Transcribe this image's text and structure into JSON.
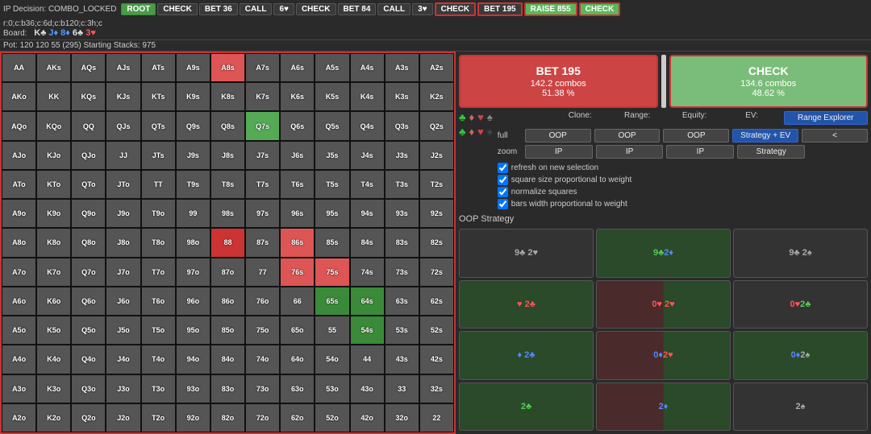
{
  "nav": {
    "ip_decision": "IP Decision: COMBO_LOCKED",
    "buttons": [
      {
        "label": "ROOT",
        "style": "green"
      },
      {
        "label": "CHECK",
        "style": "dark"
      },
      {
        "label": "BET 36",
        "style": "dark"
      },
      {
        "label": "CALL",
        "style": "dark"
      },
      {
        "label": "6♥",
        "style": "dark"
      },
      {
        "label": "CHECK",
        "style": "dark"
      },
      {
        "label": "BET 84",
        "style": "dark"
      },
      {
        "label": "CALL",
        "style": "dark"
      },
      {
        "label": "3♥",
        "style": "dark"
      },
      {
        "label": "CHECK",
        "style": "red-outline"
      },
      {
        "label": "BET 195",
        "style": "red-outline"
      },
      {
        "label": "RAISE 855",
        "style": "active-green"
      },
      {
        "label": "CHECK",
        "style": "active-green"
      }
    ]
  },
  "board": {
    "label": "Board:",
    "cards": [
      {
        "text": "K♣",
        "color": "black"
      },
      {
        "text": "J♦",
        "color": "blue"
      },
      {
        "text": "8♦",
        "color": "blue"
      },
      {
        "text": "6♣",
        "color": "black"
      },
      {
        "text": "3♥",
        "color": "red"
      }
    ]
  },
  "path": "r:0;c:b36;c:6d;c:b120;c:3h;c",
  "pot_info": "Pot: 120 120 55 (295) Starting Stacks: 975",
  "actions": {
    "bet": {
      "title": "BET 195",
      "combos": "142.2 combos",
      "pct": "51.38 %"
    },
    "check": {
      "title": "CHECK",
      "combos": "134.6 combos",
      "pct": "48.62 %"
    }
  },
  "controls": {
    "clone_label": "Clone:",
    "range_label": "Range:",
    "equity_label": "Equity:",
    "ev_label": "EV:",
    "range_explorer_label": "Range Explorer",
    "full_label": "full",
    "zoom_label": "zoom",
    "oop_labels": [
      "OOP",
      "OOP",
      "OOP"
    ],
    "ip_labels": [
      "IP",
      "IP",
      "IP"
    ],
    "strategy_ev": "Strategy + EV",
    "strategy": "Strategy",
    "checkboxes": [
      "refresh on new selection",
      "square size proportional to weight",
      "normalize squares",
      "bars width proportional to weight"
    ]
  },
  "oop_strategy_label": "OOP Strategy",
  "card_cells": [
    {
      "label": "9♣",
      "suit_color": "black",
      "rank": "2♥",
      "suit2_color": "red",
      "bg": "gray"
    },
    {
      "label": "9♣",
      "suit_color": "black",
      "rank": "2♦",
      "suit2_color": "blue",
      "bg": "mixed"
    },
    {
      "label": "9♣",
      "suit_color": "black",
      "rank": "2♠",
      "suit2_color": "gray",
      "bg": "gray"
    },
    {
      "label": "♥",
      "suit_color": "red",
      "rank": "2♣",
      "suit2_color": "green",
      "bg": "green"
    },
    {
      "label": "0♥",
      "suit_color": "red",
      "rank": "2♥",
      "suit2_color": "red",
      "bg": "mixed"
    },
    {
      "label": "0♥",
      "suit_color": "red",
      "rank": "2♣",
      "suit2_color": "green",
      "bg": "gray"
    },
    {
      "label": "♦",
      "suit_color": "blue",
      "rank": "2♣",
      "suit2_color": "green",
      "bg": "green"
    },
    {
      "label": "0♦",
      "suit_color": "blue",
      "rank": "2♥",
      "suit2_color": "red",
      "bg": "mixed"
    },
    {
      "label": "0♦",
      "suit_color": "blue",
      "rank": "2♠",
      "suit2_color": "gray",
      "bg": "green"
    },
    {
      "label": "2♣",
      "suit_color": "green",
      "rank": "",
      "suit2_color": "",
      "bg": "green"
    },
    {
      "label": "2♦",
      "suit_color": "blue",
      "rank": "",
      "suit2_color": "",
      "bg": "mixed"
    },
    {
      "label": "2♠",
      "suit_color": "gray",
      "rank": "",
      "suit2_color": "",
      "bg": "gray"
    }
  ],
  "grid_cells": [
    {
      "label": "AA",
      "c": "c-gray"
    },
    {
      "label": "AKs",
      "c": "c-gray"
    },
    {
      "label": "AQs",
      "c": "c-gray"
    },
    {
      "label": "AJs",
      "c": "c-gray"
    },
    {
      "label": "ATs",
      "c": "c-gray"
    },
    {
      "label": "A9s",
      "c": "c-gray"
    },
    {
      "label": "A8s",
      "c": "c-lred"
    },
    {
      "label": "A7s",
      "c": "c-gray"
    },
    {
      "label": "A6s",
      "c": "c-gray"
    },
    {
      "label": "A5s",
      "c": "c-gray"
    },
    {
      "label": "A4s",
      "c": "c-gray"
    },
    {
      "label": "A3s",
      "c": "c-gray"
    },
    {
      "label": "A2s",
      "c": "c-gray"
    },
    {
      "label": "AKo",
      "c": "c-gray"
    },
    {
      "label": "KK",
      "c": "c-gray"
    },
    {
      "label": "KQs",
      "c": "c-gray"
    },
    {
      "label": "KJs",
      "c": "c-gray"
    },
    {
      "label": "KTs",
      "c": "c-gray"
    },
    {
      "label": "K9s",
      "c": "c-gray"
    },
    {
      "label": "K8s",
      "c": "c-gray"
    },
    {
      "label": "K7s",
      "c": "c-gray"
    },
    {
      "label": "K6s",
      "c": "c-gray"
    },
    {
      "label": "K5s",
      "c": "c-gray"
    },
    {
      "label": "K4s",
      "c": "c-gray"
    },
    {
      "label": "K3s",
      "c": "c-gray"
    },
    {
      "label": "K2s",
      "c": "c-gray"
    },
    {
      "label": "AQo",
      "c": "c-gray"
    },
    {
      "label": "KQo",
      "c": "c-gray"
    },
    {
      "label": "QQ",
      "c": "c-gray"
    },
    {
      "label": "QJs",
      "c": "c-gray"
    },
    {
      "label": "QTs",
      "c": "c-gray"
    },
    {
      "label": "Q9s",
      "c": "c-gray"
    },
    {
      "label": "Q8s",
      "c": "c-gray"
    },
    {
      "label": "Q7s",
      "c": "c-lgreen"
    },
    {
      "label": "Q6s",
      "c": "c-gray"
    },
    {
      "label": "Q5s",
      "c": "c-gray"
    },
    {
      "label": "Q4s",
      "c": "c-gray"
    },
    {
      "label": "Q3s",
      "c": "c-gray"
    },
    {
      "label": "Q2s",
      "c": "c-gray"
    },
    {
      "label": "AJo",
      "c": "c-gray"
    },
    {
      "label": "KJo",
      "c": "c-gray"
    },
    {
      "label": "QJo",
      "c": "c-gray"
    },
    {
      "label": "JJ",
      "c": "c-gray"
    },
    {
      "label": "JTs",
      "c": "c-gray"
    },
    {
      "label": "J9s",
      "c": "c-gray"
    },
    {
      "label": "J8s",
      "c": "c-gray"
    },
    {
      "label": "J7s",
      "c": "c-gray"
    },
    {
      "label": "J6s",
      "c": "c-gray"
    },
    {
      "label": "J5s",
      "c": "c-gray"
    },
    {
      "label": "J4s",
      "c": "c-gray"
    },
    {
      "label": "J3s",
      "c": "c-gray"
    },
    {
      "label": "J2s",
      "c": "c-gray"
    },
    {
      "label": "ATo",
      "c": "c-gray"
    },
    {
      "label": "KTo",
      "c": "c-gray"
    },
    {
      "label": "QTo",
      "c": "c-gray"
    },
    {
      "label": "JTo",
      "c": "c-gray"
    },
    {
      "label": "TT",
      "c": "c-gray"
    },
    {
      "label": "T9s",
      "c": "c-gray"
    },
    {
      "label": "T8s",
      "c": "c-gray"
    },
    {
      "label": "T7s",
      "c": "c-gray"
    },
    {
      "label": "T6s",
      "c": "c-gray"
    },
    {
      "label": "T5s",
      "c": "c-gray"
    },
    {
      "label": "T4s",
      "c": "c-gray"
    },
    {
      "label": "T3s",
      "c": "c-gray"
    },
    {
      "label": "T2s",
      "c": "c-gray"
    },
    {
      "label": "A9o",
      "c": "c-gray"
    },
    {
      "label": "K9o",
      "c": "c-gray"
    },
    {
      "label": "Q9o",
      "c": "c-gray"
    },
    {
      "label": "J9o",
      "c": "c-gray"
    },
    {
      "label": "T9o",
      "c": "c-gray"
    },
    {
      "label": "99",
      "c": "c-gray"
    },
    {
      "label": "98s",
      "c": "c-gray"
    },
    {
      "label": "97s",
      "c": "c-gray"
    },
    {
      "label": "96s",
      "c": "c-gray"
    },
    {
      "label": "95s",
      "c": "c-gray"
    },
    {
      "label": "94s",
      "c": "c-gray"
    },
    {
      "label": "93s",
      "c": "c-gray"
    },
    {
      "label": "92s",
      "c": "c-gray"
    },
    {
      "label": "A8o",
      "c": "c-gray"
    },
    {
      "label": "K8o",
      "c": "c-gray"
    },
    {
      "label": "Q8o",
      "c": "c-gray"
    },
    {
      "label": "J8o",
      "c": "c-gray"
    },
    {
      "label": "T8o",
      "c": "c-gray"
    },
    {
      "label": "98o",
      "c": "c-gray"
    },
    {
      "label": "88",
      "c": "c-red"
    },
    {
      "label": "87s",
      "c": "c-gray"
    },
    {
      "label": "86s",
      "c": "c-lred"
    },
    {
      "label": "85s",
      "c": "c-gray"
    },
    {
      "label": "84s",
      "c": "c-gray"
    },
    {
      "label": "83s",
      "c": "c-gray"
    },
    {
      "label": "82s",
      "c": "c-gray"
    },
    {
      "label": "A7o",
      "c": "c-gray"
    },
    {
      "label": "K7o",
      "c": "c-gray"
    },
    {
      "label": "Q7o",
      "c": "c-gray"
    },
    {
      "label": "J7o",
      "c": "c-gray"
    },
    {
      "label": "T7o",
      "c": "c-gray"
    },
    {
      "label": "97o",
      "c": "c-gray"
    },
    {
      "label": "87o",
      "c": "c-gray"
    },
    {
      "label": "77",
      "c": "c-gray"
    },
    {
      "label": "76s",
      "c": "c-lred"
    },
    {
      "label": "75s",
      "c": "c-lred"
    },
    {
      "label": "74s",
      "c": "c-gray"
    },
    {
      "label": "73s",
      "c": "c-gray"
    },
    {
      "label": "72s",
      "c": "c-gray"
    },
    {
      "label": "A6o",
      "c": "c-gray"
    },
    {
      "label": "K6o",
      "c": "c-gray"
    },
    {
      "label": "Q6o",
      "c": "c-gray"
    },
    {
      "label": "J6o",
      "c": "c-gray"
    },
    {
      "label": "T6o",
      "c": "c-gray"
    },
    {
      "label": "96o",
      "c": "c-gray"
    },
    {
      "label": "86o",
      "c": "c-gray"
    },
    {
      "label": "76o",
      "c": "c-gray"
    },
    {
      "label": "66",
      "c": "c-gray"
    },
    {
      "label": "65s",
      "c": "c-green"
    },
    {
      "label": "64s",
      "c": "c-green"
    },
    {
      "label": "63s",
      "c": "c-gray"
    },
    {
      "label": "62s",
      "c": "c-gray"
    },
    {
      "label": "A5o",
      "c": "c-gray"
    },
    {
      "label": "K5o",
      "c": "c-gray"
    },
    {
      "label": "Q5o",
      "c": "c-gray"
    },
    {
      "label": "J5o",
      "c": "c-gray"
    },
    {
      "label": "T5o",
      "c": "c-gray"
    },
    {
      "label": "95o",
      "c": "c-gray"
    },
    {
      "label": "85o",
      "c": "c-gray"
    },
    {
      "label": "75o",
      "c": "c-gray"
    },
    {
      "label": "65o",
      "c": "c-gray"
    },
    {
      "label": "55",
      "c": "c-gray"
    },
    {
      "label": "54s",
      "c": "c-green"
    },
    {
      "label": "53s",
      "c": "c-gray"
    },
    {
      "label": "52s",
      "c": "c-gray"
    },
    {
      "label": "A4o",
      "c": "c-gray"
    },
    {
      "label": "K4o",
      "c": "c-gray"
    },
    {
      "label": "Q4o",
      "c": "c-gray"
    },
    {
      "label": "J4o",
      "c": "c-gray"
    },
    {
      "label": "T4o",
      "c": "c-gray"
    },
    {
      "label": "94o",
      "c": "c-gray"
    },
    {
      "label": "84o",
      "c": "c-gray"
    },
    {
      "label": "74o",
      "c": "c-gray"
    },
    {
      "label": "64o",
      "c": "c-gray"
    },
    {
      "label": "54o",
      "c": "c-gray"
    },
    {
      "label": "44",
      "c": "c-gray"
    },
    {
      "label": "43s",
      "c": "c-gray"
    },
    {
      "label": "42s",
      "c": "c-gray"
    },
    {
      "label": "A3o",
      "c": "c-gray"
    },
    {
      "label": "K3o",
      "c": "c-gray"
    },
    {
      "label": "Q3o",
      "c": "c-gray"
    },
    {
      "label": "J3o",
      "c": "c-gray"
    },
    {
      "label": "T3o",
      "c": "c-gray"
    },
    {
      "label": "93o",
      "c": "c-gray"
    },
    {
      "label": "83o",
      "c": "c-gray"
    },
    {
      "label": "73o",
      "c": "c-gray"
    },
    {
      "label": "63o",
      "c": "c-gray"
    },
    {
      "label": "53o",
      "c": "c-gray"
    },
    {
      "label": "43o",
      "c": "c-gray"
    },
    {
      "label": "33",
      "c": "c-gray"
    },
    {
      "label": "32s",
      "c": "c-gray"
    },
    {
      "label": "A2o",
      "c": "c-gray"
    },
    {
      "label": "K2o",
      "c": "c-gray"
    },
    {
      "label": "Q2o",
      "c": "c-gray"
    },
    {
      "label": "J2o",
      "c": "c-gray"
    },
    {
      "label": "T2o",
      "c": "c-gray"
    },
    {
      "label": "92o",
      "c": "c-gray"
    },
    {
      "label": "82o",
      "c": "c-gray"
    },
    {
      "label": "72o",
      "c": "c-gray"
    },
    {
      "label": "62o",
      "c": "c-gray"
    },
    {
      "label": "52o",
      "c": "c-gray"
    },
    {
      "label": "42o",
      "c": "c-gray"
    },
    {
      "label": "32o",
      "c": "c-gray"
    },
    {
      "label": "22",
      "c": "c-gray"
    }
  ]
}
